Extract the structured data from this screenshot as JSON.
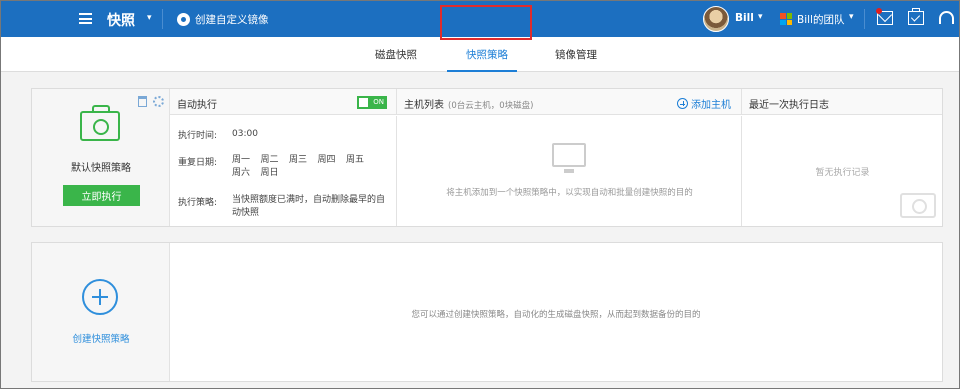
{
  "header": {
    "app_title": "快照",
    "custom_image_label": "创建自定义镜像",
    "user_name": "Bill",
    "team_name": "Bill的团队",
    "brand_color": "#1c6fc0"
  },
  "tabs": [
    {
      "label": "磁盘快照",
      "active": false
    },
    {
      "label": "快照策略",
      "active": true
    },
    {
      "label": "镜像管理",
      "active": false
    }
  ],
  "policy": {
    "name": "默认快照策略",
    "run_button": "立即执行",
    "auto": {
      "title": "自动执行",
      "toggle": "ON",
      "time_key": "执行时间:",
      "time_value": "03:00",
      "repeat_key": "重复日期:",
      "days": [
        "周一",
        "周二",
        "周三",
        "周四",
        "周五",
        "周六",
        "周日"
      ],
      "strategy_key": "执行策略:",
      "strategy_value": "当快照额度已满时，自动删除最早的自动快照"
    },
    "hosts": {
      "title": "主机列表",
      "subtitle": "(0台云主机，0块磁盘)",
      "add_label": "添加主机",
      "empty_text": "将主机添加到一个快照策略中，以实现自动和批量创建快照的目的"
    },
    "log": {
      "title": "最近一次执行日志",
      "empty_text": "暂无执行记录"
    }
  },
  "create": {
    "label": "创建快照策略",
    "hint": "您可以通过创建快照策略，自动化的生成磁盘快照，从而起到数据备份的目的"
  }
}
